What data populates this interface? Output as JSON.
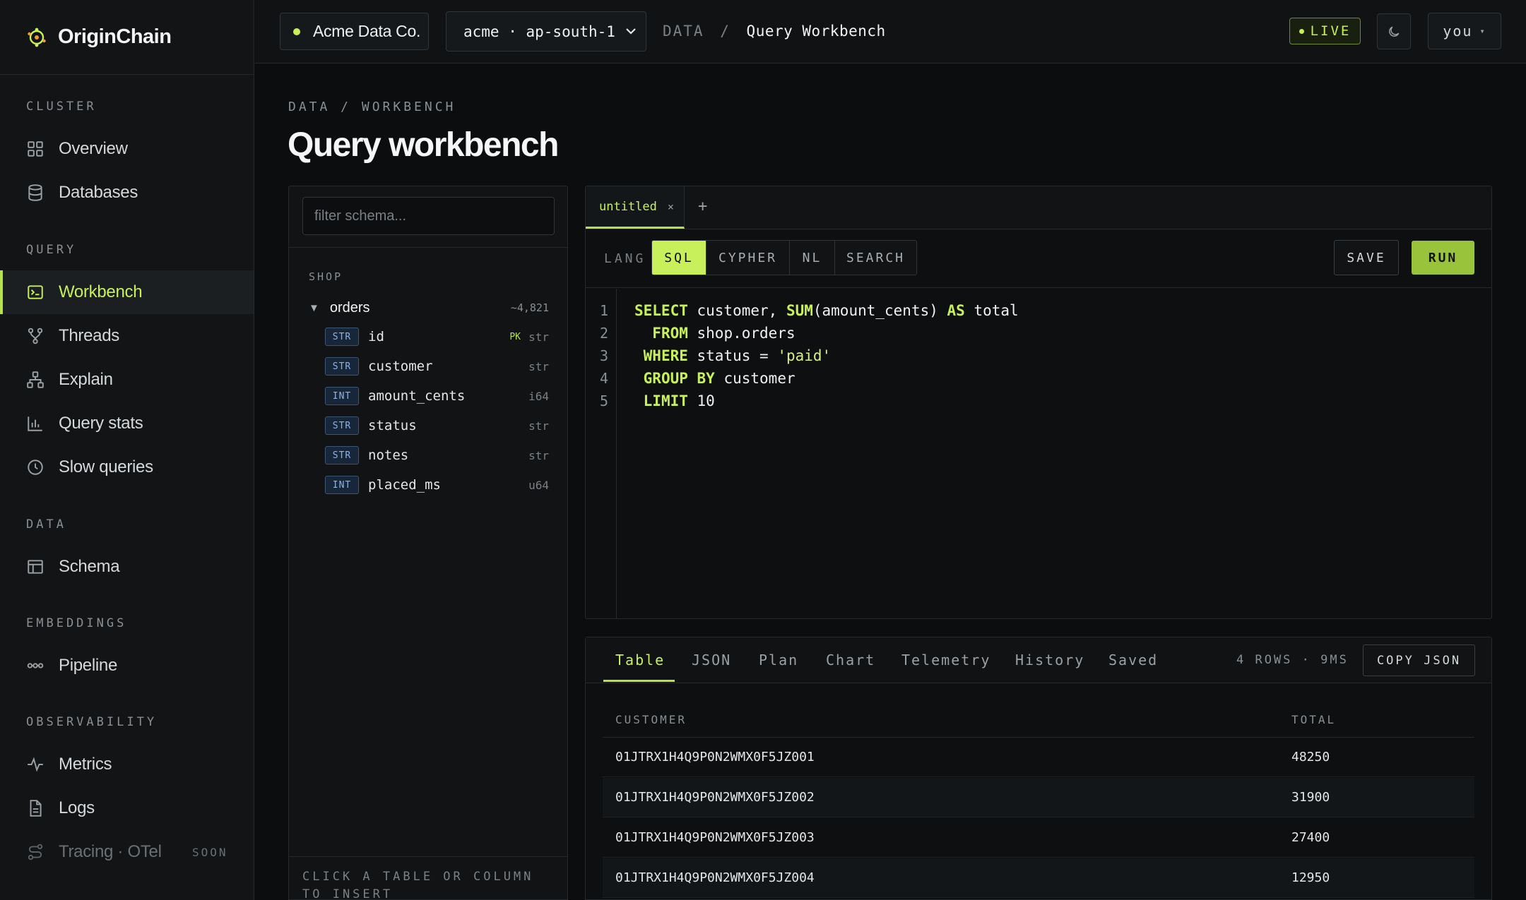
{
  "brand": {
    "name": "OriginChain"
  },
  "sidebar": {
    "sections": [
      {
        "label": "CLUSTER"
      },
      {
        "label": "QUERY"
      },
      {
        "label": "DATA"
      },
      {
        "label": "EMBEDDINGS"
      },
      {
        "label": "OBSERVABILITY"
      }
    ],
    "items": [
      {
        "label": "Overview",
        "icon": "grid-icon"
      },
      {
        "label": "Databases",
        "icon": "database-icon"
      },
      {
        "label": "Workbench",
        "icon": "terminal-icon",
        "active": true
      },
      {
        "label": "Threads",
        "icon": "branch-icon"
      },
      {
        "label": "Explain",
        "icon": "tree-icon"
      },
      {
        "label": "Query stats",
        "icon": "bar-chart-icon"
      },
      {
        "label": "Slow queries",
        "icon": "clock-icon"
      },
      {
        "label": "Schema",
        "icon": "table-icon"
      },
      {
        "label": "Pipeline",
        "icon": "pipeline-icon"
      },
      {
        "label": "Metrics",
        "icon": "activity-icon"
      },
      {
        "label": "Logs",
        "icon": "file-icon"
      },
      {
        "label": "Tracing · OTel",
        "icon": "trace-icon",
        "disabled": true,
        "badge": "SOON"
      }
    ]
  },
  "topbar": {
    "org": "Acme Data Co.",
    "region": "acme · ap-south-1",
    "breadcrumb_parent": "DATA",
    "breadcrumb_sep": "/",
    "breadcrumb_current": "Query Workbench",
    "live_label": "LIVE",
    "user_label": "you",
    "user_caret": "▾",
    "accent": "#c8f05a"
  },
  "page": {
    "breadcrumb": "DATA / WORKBENCH",
    "title": "Query workbench"
  },
  "schema": {
    "filter_placeholder": "filter schema...",
    "group": "SHOP",
    "table": {
      "name": "orders",
      "count": "~4,821",
      "expanded_icon": "▼"
    },
    "columns": [
      {
        "type": "STR",
        "name": "id",
        "pk": "PK",
        "dtype": "str"
      },
      {
        "type": "STR",
        "name": "customer",
        "pk": "",
        "dtype": "str"
      },
      {
        "type": "INT",
        "name": "amount_cents",
        "pk": "",
        "dtype": "i64"
      },
      {
        "type": "STR",
        "name": "status",
        "pk": "",
        "dtype": "str"
      },
      {
        "type": "STR",
        "name": "notes",
        "pk": "",
        "dtype": "str"
      },
      {
        "type": "INT",
        "name": "placed_ms",
        "pk": "",
        "dtype": "u64"
      }
    ],
    "footer_hint": "CLICK A TABLE OR COLUMN TO INSERT"
  },
  "editor": {
    "tab_name": "untitled",
    "tab_close": "×",
    "new_tab": "+",
    "lang_label": "LANG",
    "langs": [
      "SQL",
      "CYPHER",
      "NL",
      "SEARCH"
    ],
    "selected_lang": "SQL",
    "save_label": "SAVE",
    "run_label": "RUN",
    "line_numbers": [
      "1",
      "2",
      "3",
      "4",
      "5"
    ],
    "code_lines": [
      "SELECT customer, SUM(amount_cents) AS total",
      "  FROM shop.orders",
      " WHERE status = 'paid'",
      " GROUP BY customer",
      " LIMIT 10"
    ]
  },
  "results": {
    "tabs": [
      "Table",
      "JSON",
      "Plan",
      "Chart",
      "Telemetry",
      "History",
      "Saved"
    ],
    "active_tab": "Table",
    "meta": "4 ROWS · 9MS",
    "copy_label": "COPY JSON",
    "columns": [
      "CUSTOMER",
      "TOTAL"
    ],
    "rows": [
      [
        "01JTRX1H4Q9P0N2WMX0F5JZ001",
        "48250"
      ],
      [
        "01JTRX1H4Q9P0N2WMX0F5JZ002",
        "31900"
      ],
      [
        "01JTRX1H4Q9P0N2WMX0F5JZ003",
        "27400"
      ],
      [
        "01JTRX1H4Q9P0N2WMX0F5JZ004",
        "12950"
      ]
    ]
  }
}
